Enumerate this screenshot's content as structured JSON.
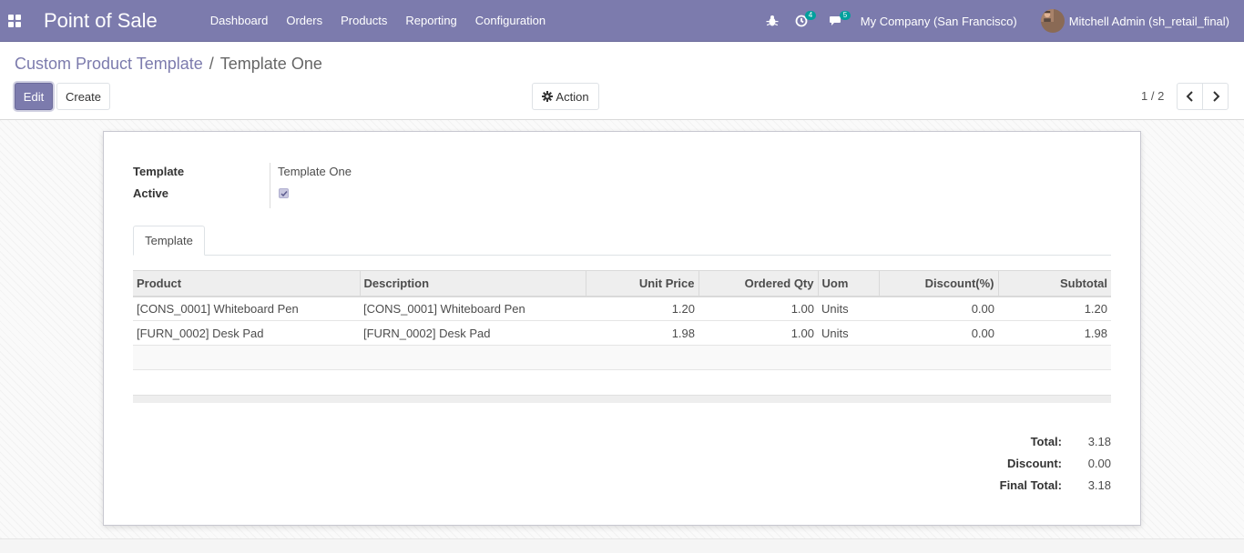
{
  "navbar": {
    "app_title": "Point of Sale",
    "menu": [
      "Dashboard",
      "Orders",
      "Products",
      "Reporting",
      "Configuration"
    ],
    "activity_count": "4",
    "message_count": "5",
    "company": "My Company (San Francisco)",
    "user": "Mitchell Admin (sh_retail_final)"
  },
  "breadcrumb": {
    "parent": "Custom Product Template",
    "separator": "/",
    "current": "Template One"
  },
  "buttons": {
    "edit": "Edit",
    "create": "Create",
    "action": "Action"
  },
  "pager": {
    "value": "1 / 2"
  },
  "form": {
    "template_label": "Template",
    "template_value": "Template One",
    "active_label": "Active",
    "active_checked": true
  },
  "tabs": [
    "Template"
  ],
  "lines": {
    "columns": [
      "Product",
      "Description",
      "Unit Price",
      "Ordered Qty",
      "Uom",
      "Discount(%)",
      "Subtotal"
    ],
    "rows": [
      [
        "[CONS_0001] Whiteboard Pen",
        "[CONS_0001] Whiteboard Pen",
        "1.20",
        "1.00",
        "Units",
        "0.00",
        "1.20"
      ],
      [
        "[FURN_0002] Desk Pad",
        "[FURN_0002] Desk Pad",
        "1.98",
        "1.00",
        "Units",
        "0.00",
        "1.98"
      ]
    ]
  },
  "totals": {
    "total_label": "Total:",
    "total_value": "3.18",
    "discount_label": "Discount:",
    "discount_value": "0.00",
    "final_label": "Final Total:",
    "final_value": "3.18"
  },
  "colors": {
    "brand": "#7c7bad",
    "badge": "#00a09d"
  }
}
